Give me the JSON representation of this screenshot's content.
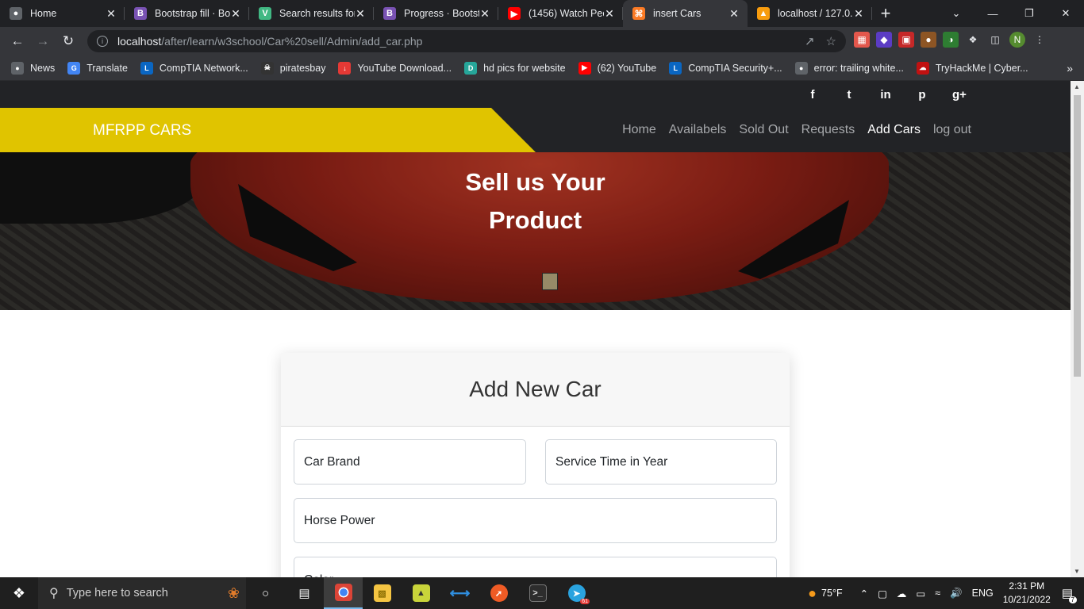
{
  "browser": {
    "tabs": [
      {
        "title": "Home",
        "icon": "globe-icon",
        "color": "#5f6368",
        "glyph": "●",
        "active": false
      },
      {
        "title": "Bootstrap fill · Bo",
        "icon": "bootstrap-icon",
        "color": "#7952b3",
        "glyph": "B",
        "active": false
      },
      {
        "title": "Search results for",
        "icon": "vue-icon",
        "color": "#41b883",
        "glyph": "V",
        "active": false
      },
      {
        "title": "Progress · Bootst",
        "icon": "bootstrap-icon",
        "color": "#7952b3",
        "glyph": "B",
        "active": false
      },
      {
        "title": "(1456) Watch Peo",
        "icon": "youtube-icon",
        "color": "#ff0000",
        "glyph": "▶",
        "active": false
      },
      {
        "title": "insert Cars",
        "icon": "xampp-icon",
        "color": "#fb7a24",
        "glyph": "⌘",
        "active": true
      },
      {
        "title": "localhost / 127.0.",
        "icon": "phpmyadmin-icon",
        "color": "#f89c0e",
        "glyph": "▲",
        "active": false
      }
    ],
    "url_host": "localhost",
    "url_path": "/after/learn/w3school/Car%20sell/Admin/add_car.php",
    "profile_initial": "N",
    "bookmarks": [
      {
        "label": "News",
        "icon": "globe-icon",
        "color": "#5f6368",
        "glyph": "●"
      },
      {
        "label": "Translate",
        "icon": "translate-icon",
        "color": "#4285f4",
        "glyph": "G"
      },
      {
        "label": "CompTIA Network...",
        "icon": "linkedin-learning-icon",
        "color": "#0a66c2",
        "glyph": "L"
      },
      {
        "label": "piratesbay",
        "icon": "pirate-icon",
        "color": "#333333",
        "glyph": "☠"
      },
      {
        "label": "YouTube Download...",
        "icon": "download-icon",
        "color": "#e53935",
        "glyph": "↓"
      },
      {
        "label": "hd pics for website",
        "icon": "image-icon",
        "color": "#26a69a",
        "glyph": "D"
      },
      {
        "label": "(62) YouTube",
        "icon": "youtube-icon",
        "color": "#ff0000",
        "glyph": "▶"
      },
      {
        "label": "CompTIA Security+...",
        "icon": "linkedin-learning-icon",
        "color": "#0a66c2",
        "glyph": "L"
      },
      {
        "label": "error: trailing white...",
        "icon": "globe-icon",
        "color": "#5f6368",
        "glyph": "●"
      },
      {
        "label": "TryHackMe | Cyber...",
        "icon": "tryhackme-icon",
        "color": "#c11111",
        "glyph": "☁"
      }
    ]
  },
  "site": {
    "social": [
      "f",
      "t",
      "in",
      "p",
      "g+"
    ],
    "brand": "MFRPP CARS",
    "nav": [
      "Home",
      "Availabels",
      "Sold Out",
      "Requests",
      "Add Cars",
      "log out"
    ],
    "hero_line1": "Sell us Your",
    "hero_line2": "Product",
    "form_title": "Add New Car",
    "fields": {
      "brand": "Car Brand",
      "service": "Service Time in Year",
      "horsepower": "Horse Power",
      "next": "Color"
    },
    "colors": {
      "accent": "#e0c400",
      "navbar": "#222326"
    }
  },
  "taskbar": {
    "search_placeholder": "Type here to search",
    "weather": "75°F",
    "lang": "ENG",
    "time": "2:31 PM",
    "date": "10/21/2022",
    "notifications": "7",
    "telegram_badge": "61"
  }
}
